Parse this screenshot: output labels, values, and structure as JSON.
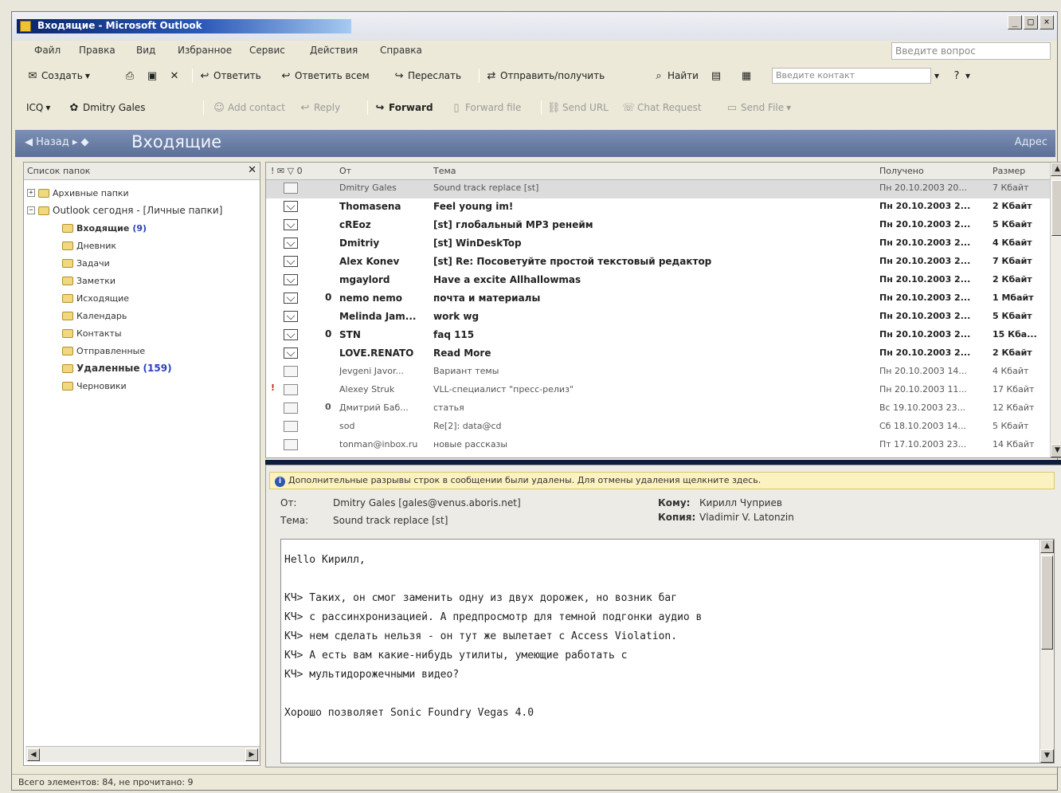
{
  "window": {
    "title": "Входящие - Microsoft Outlook"
  },
  "menu": {
    "items": [
      "Файл",
      "Правка",
      "Вид",
      "Избранное",
      "Сервис",
      "Действия",
      "Справка"
    ],
    "help_placeholder": "Введите вопрос"
  },
  "toolbar1": {
    "create": "Создать",
    "reply": "Ответить",
    "reply_all": "Ответить всем",
    "forward": "Переслать",
    "send_receive": "Отправить/получить",
    "find": "Найти",
    "contact_placeholder": "Введите контакт"
  },
  "toolbar2": {
    "icq": "ICQ",
    "user": "Dmitry Gales",
    "btn_a": "Add contact",
    "btn_b": "Reply",
    "btn_forward": "Forward",
    "btn_c": "Forward file",
    "btn_d": "Send URL",
    "btn_e": "Chat Request",
    "btn_f": "Send File"
  },
  "band": {
    "back": "Назад",
    "title": "Входящие",
    "right": "Адрес"
  },
  "folders": {
    "header": "Список папок",
    "items": [
      {
        "label": "Архивные папки",
        "count": ""
      },
      {
        "label": "Outlook сегодня - [Личные папки]",
        "count": ""
      },
      {
        "label": "Входящие",
        "count": "(9)"
      },
      {
        "label": "Дневник",
        "count": ""
      },
      {
        "label": "Задачи",
        "count": ""
      },
      {
        "label": "Заметки",
        "count": ""
      },
      {
        "label": "Исходящие",
        "count": ""
      },
      {
        "label": "Календарь",
        "count": ""
      },
      {
        "label": "Контакты",
        "count": ""
      },
      {
        "label": "Отправленные",
        "count": ""
      },
      {
        "label": "Удаленные",
        "count": "(159)"
      },
      {
        "label": "Черновики",
        "count": ""
      }
    ]
  },
  "list": {
    "columns": {
      "icons": "! ✉ ▽ 0",
      "from": "От",
      "subject": "Тема",
      "received": "Получено",
      "size": "Размер"
    },
    "rows": [
      {
        "from": "Dmitry Gales",
        "subject": "Sound track replace [st]",
        "date": "Пн 20.10.2003 20...",
        "size": "7 Кбайт"
      },
      {
        "from": "Thomasena",
        "subject": "Feel young im!",
        "date": "Пн 20.10.2003 2...",
        "size": "2 Кбайт"
      },
      {
        "from": "cREoz",
        "subject": "[st] глобальный MP3 ренейм",
        "date": "Пн 20.10.2003 2...",
        "size": "5 Кбайт"
      },
      {
        "from": "Dmitriy",
        "subject": "[st] WinDeskTop",
        "date": "Пн 20.10.2003 2...",
        "size": "4 Кбайт"
      },
      {
        "from": "Alex Konev",
        "subject": "[st] Re: Посоветуйте простой текстовый редактор",
        "date": "Пн 20.10.2003 2...",
        "size": "7 Кбайт"
      },
      {
        "from": "mgaylord",
        "subject": "Have a excite Allhallowmas",
        "date": "Пн 20.10.2003 2...",
        "size": "2 Кбайт"
      },
      {
        "from": "nemo nemo",
        "subject": "почта и материалы",
        "date": "Пн 20.10.2003 2...",
        "size": "1 Мбайт"
      },
      {
        "from": "Melinda Jam...",
        "subject": "work wg",
        "date": "Пн 20.10.2003 2...",
        "size": "5 Кбайт"
      },
      {
        "from": "STN",
        "subject": "faq 115",
        "date": "Пн 20.10.2003 2...",
        "size": "15 Кба..."
      },
      {
        "from": "LOVE.RENATO",
        "subject": "Read More",
        "date": "Пн 20.10.2003 2...",
        "size": "2 Кбайт"
      },
      {
        "from": "Jevgeni Javor...",
        "subject": "Вариант темы",
        "date": "Пн 20.10.2003 14...",
        "size": "4 Кбайт"
      },
      {
        "from": "Alexey Struk",
        "subject": "VLL-специалист \"пресс-релиз\"",
        "date": "Пн 20.10.2003 11...",
        "size": "17 Кбайт"
      },
      {
        "from": "Дмитрий Баб...",
        "subject": "статья",
        "date": "Вс 19.10.2003 23...",
        "size": "12 Кбайт"
      },
      {
        "from": "sod",
        "subject": "Re[2]: data@cd",
        "date": "Сб 18.10.2003 14...",
        "size": "5 Кбайт"
      },
      {
        "from": "tonman@inbox.ru",
        "subject": "новые рассказы",
        "date": "Пт 17.10.2003 23...",
        "size": "14 Кбайт"
      }
    ]
  },
  "preview": {
    "infobar": "Дополнительные разрывы строк в сообщении были удалены. Для отмены удаления щелкните здесь.",
    "from_label": "От:",
    "from_value": "Dmitry Gales [gales@venus.aboris.net]",
    "subject_label": "Тема:",
    "subject_value": "Sound track replace [st]",
    "to_label": "Кому:",
    "to_value": "Кирилл Чуприев",
    "cc_label": "Копия:",
    "cc_value": "Vladimir V. Latonzin",
    "body": [
      "Hello Кирилл,",
      "",
      "КЧ> Таких, он смог заменить одну из двух дорожек, но возник баг",
      "КЧ> с рассинхронизацией. А предпросмотр для темной подгонки аудио в",
      "КЧ> нем сделать нельзя - он тут же вылетает с Access Violation.",
      "КЧ> А есть вам какие-нибудь утилиты, умеющие работать с",
      "КЧ> мультидорожечными видео?",
      "",
      "Хорошо позволяет Sonic Foundry Vegas 4.0"
    ]
  },
  "status": {
    "text": "Всего элементов: 84, не прочитано: 9"
  }
}
